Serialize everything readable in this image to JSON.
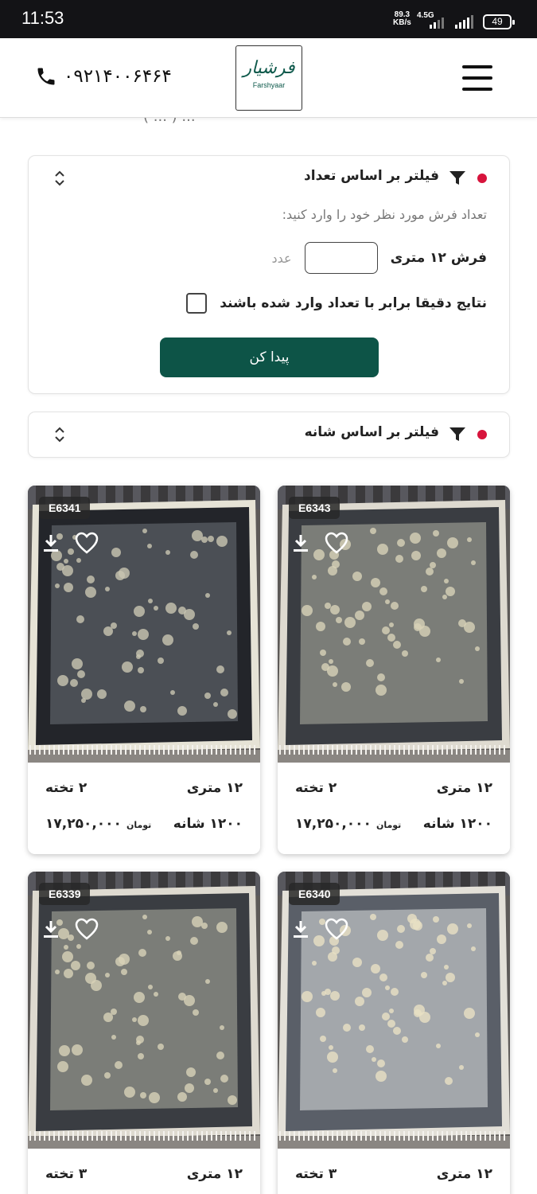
{
  "status_bar": {
    "time": "11:53",
    "speed_value": "89.3",
    "speed_unit": "KB/s",
    "network": "4.5G",
    "battery": "49"
  },
  "header": {
    "phone": "۰۹۲۱۴۰۰۶۴۶۴",
    "logo_fa": "فرشیار",
    "logo_en": "Farshyaar",
    "partial_text": "( ... ) ..."
  },
  "count_filter": {
    "title": "فیلتر بر اساس تعداد",
    "hint": "تعداد فرش مورد نظر خود را وارد کنید:",
    "quantity_label": "فرش ۱۲ متری",
    "quantity_value": "",
    "unit": "عدد",
    "exact_label": "نتایج دقیقا برابر با تعداد وارد شده باشند",
    "button": "پیدا کن"
  },
  "density_filter": {
    "title": "فیلتر بر اساس شانه"
  },
  "colors": {
    "brand": "#0d5447",
    "accent_dot": "#d7143c"
  },
  "products": [
    {
      "code": "E6341",
      "size": "۱۲ متری",
      "pieces": "۲ تخته",
      "density": "۱۲۰۰ شانه",
      "price": "۱۷,۲۵۰,۰۰۰",
      "currency": "تومان",
      "palette": "dark"
    },
    {
      "code": "E6343",
      "size": "۱۲ متری",
      "pieces": "۲ تخته",
      "density": "۱۲۰۰ شانه",
      "price": "۱۷,۲۵۰,۰۰۰",
      "currency": "تومان",
      "palette": "grey"
    },
    {
      "code": "E6339",
      "size": "۱۲ متری",
      "pieces": "۳ تخته",
      "density": "",
      "price": "",
      "currency": "",
      "palette": "grey"
    },
    {
      "code": "E6340",
      "size": "۱۲ متری",
      "pieces": "۳ تخته",
      "density": "",
      "price": "",
      "currency": "",
      "palette": "light"
    }
  ]
}
